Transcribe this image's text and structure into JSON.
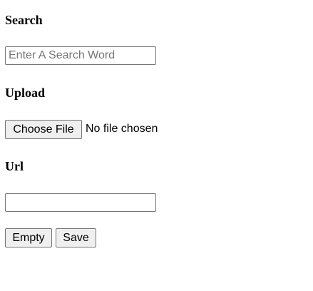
{
  "search": {
    "heading": "Search",
    "placeholder": "Enter A Search Word",
    "value": ""
  },
  "upload": {
    "heading": "Upload",
    "choose_label": "Choose File",
    "status": "No file chosen"
  },
  "url": {
    "heading": "Url",
    "value": "",
    "placeholder": ""
  },
  "actions": {
    "empty_label": "Empty",
    "save_label": "Save"
  }
}
